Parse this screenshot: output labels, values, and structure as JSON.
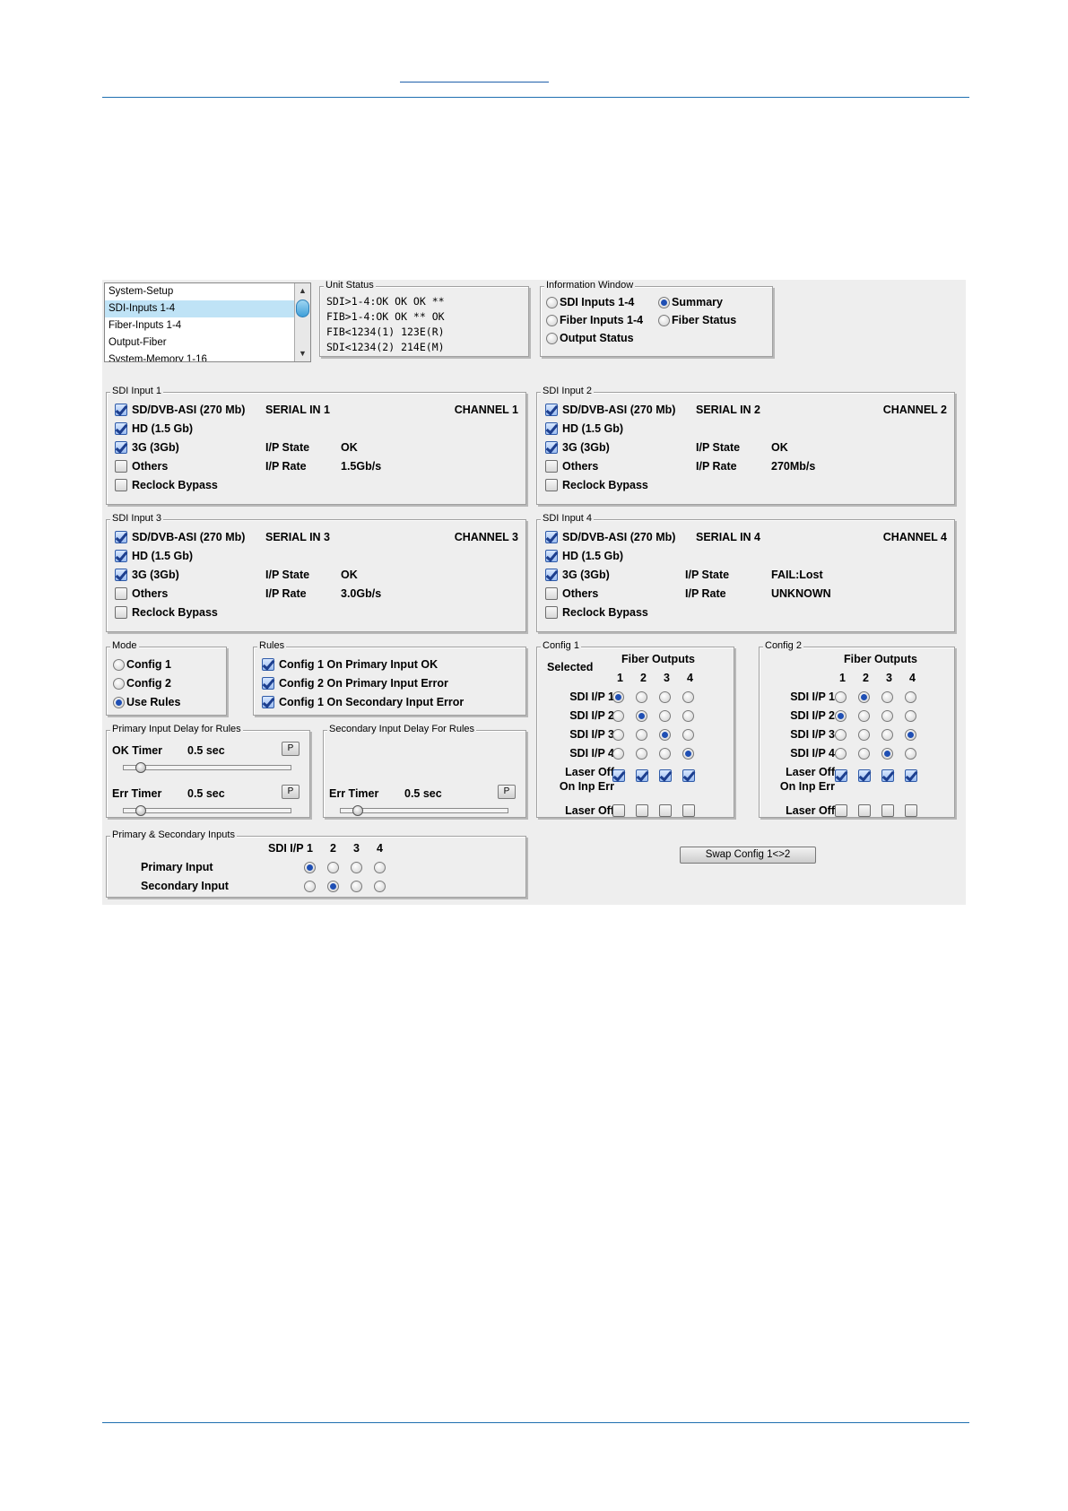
{
  "doc": {
    "header_link": ""
  },
  "nav": {
    "items": [
      "System-Setup",
      "SDI-Inputs 1-4",
      "Fiber-Inputs 1-4",
      "Output-Fiber",
      "System-Memory 1-16"
    ],
    "selected": 1
  },
  "unit_status": {
    "title": "Unit Status",
    "lines": [
      "SDI>1-4:OK OK OK **",
      "FIB>1-4:OK OK ** OK",
      "FIB<1234(1) 123E(R)",
      "SDI<1234(2) 214E(M)"
    ]
  },
  "info_window": {
    "title": "Information Window",
    "options": [
      "SDI Inputs 1-4",
      "Fiber Inputs 1-4",
      "Output Status",
      "Summary",
      "Fiber Status"
    ],
    "selected": "Summary"
  },
  "sdi_inputs": [
    {
      "title": "SDI Input 1",
      "serial": "SERIAL IN 1",
      "channel": "CHANNEL 1",
      "state_label": "I/P State",
      "state": "OK",
      "rate_label": "I/P Rate",
      "rate": "1.5Gb/s",
      "checks": [
        true,
        true,
        true,
        false,
        false
      ]
    },
    {
      "title": "SDI Input 2",
      "serial": "SERIAL IN 2",
      "channel": "CHANNEL 2",
      "state_label": "I/P State",
      "state": "OK",
      "rate_label": "I/P Rate",
      "rate": "270Mb/s",
      "checks": [
        true,
        true,
        true,
        false,
        false
      ]
    },
    {
      "title": "SDI Input 3",
      "serial": "SERIAL IN 3",
      "channel": "CHANNEL 3",
      "state_label": "I/P State",
      "state": "OK",
      "rate_label": "I/P Rate",
      "rate": "3.0Gb/s",
      "checks": [
        true,
        true,
        true,
        false,
        false
      ]
    },
    {
      "title": "SDI Input 4",
      "serial": "SERIAL IN 4",
      "channel": "CHANNEL 4",
      "state_label": "I/P State",
      "state": "FAIL:Lost",
      "rate_label": "I/P Rate",
      "rate": "UNKNOWN",
      "checks": [
        true,
        true,
        true,
        false,
        false
      ]
    }
  ],
  "format_labels": [
    "SD/DVB-ASI (270 Mb)",
    "HD (1.5 Gb)",
    "3G (3Gb)",
    "Others",
    "Reclock Bypass"
  ],
  "mode": {
    "title": "Mode",
    "options": [
      "Config 1",
      "Config 2",
      "Use Rules"
    ],
    "selected": 2
  },
  "rules": {
    "title": "Rules",
    "items": [
      "Config 1 On Primary Input OK",
      "Config 2 On Primary Input Error",
      "Config 1 On Secondary Input Error"
    ],
    "checked": [
      true,
      true,
      true
    ]
  },
  "primary_delay": {
    "title": "Primary Input Delay for Rules",
    "ok_label": "OK Timer",
    "ok_value": "0.5 sec",
    "err_label": "Err Timer",
    "err_value": "0.5 sec",
    "p": "P",
    "ok_level": 0.1,
    "err_level": 0.1
  },
  "secondary_delay": {
    "title": "Secondary Input Delay For Rules",
    "err_label": "Err Timer",
    "err_value": "0.5 sec",
    "p": "P",
    "err_level": 0.1
  },
  "configs": [
    {
      "title": "Config 1",
      "selected_label": "Selected",
      "fiber_label": "Fiber Outputs",
      "cols": [
        "1",
        "2",
        "3",
        "4"
      ],
      "rows": [
        "SDI I/P 1",
        "SDI I/P 2",
        "SDI I/P 3",
        "SDI I/P 4"
      ],
      "selection": [
        1,
        2,
        3,
        4
      ],
      "laser_err_label": [
        "Laser Off",
        "On Inp Err"
      ],
      "laser_err": [
        true,
        true,
        true,
        true
      ],
      "laser_off_label": "Laser Off",
      "laser_off": [
        false,
        false,
        false,
        false
      ]
    },
    {
      "title": "Config 2",
      "selected_label": "",
      "fiber_label": "Fiber Outputs",
      "cols": [
        "1",
        "2",
        "3",
        "4"
      ],
      "rows": [
        "SDI I/P 1",
        "SDI I/P 2",
        "SDI I/P 3",
        "SDI I/P 4"
      ],
      "selection": [
        2,
        1,
        4,
        3
      ],
      "laser_err_label": [
        "Laser Off",
        "On Inp Err"
      ],
      "laser_err": [
        true,
        true,
        true,
        true
      ],
      "laser_off_label": "Laser Off",
      "laser_off": [
        false,
        false,
        false,
        false
      ]
    }
  ],
  "prim_sec": {
    "title": "Primary & Secondary Inputs",
    "header": "SDI I/P",
    "cols": [
      "1",
      "2",
      "3",
      "4"
    ],
    "primary_label": "Primary Input",
    "secondary_label": "Secondary Input",
    "primary": 1,
    "secondary": 2
  },
  "swap_button": "Swap Config 1<>2"
}
